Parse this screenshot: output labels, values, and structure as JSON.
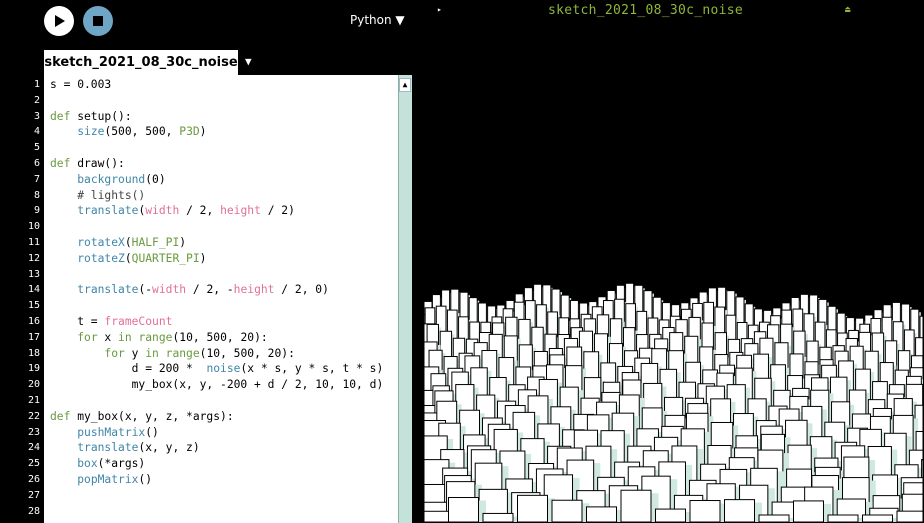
{
  "toolbar": {
    "run_icon": "play-icon",
    "stop_icon": "stop-icon",
    "mode_label": "Python ▼"
  },
  "tab": {
    "name": "sketch_2021_08_30c_noise",
    "menu_icon": "▼"
  },
  "sketch_window": {
    "title": "sketch_2021_08_30c_noise",
    "play_icon": "▸",
    "eject_icon": "⏏"
  },
  "colors": {
    "keyword": "#6a9a3f",
    "builtin": "#3f86a8",
    "constant": "#e0709a",
    "scrollbar": "#c5e2da",
    "stop_button": "#6fa6c6"
  },
  "code": [
    [
      [
        "s = 0.003",
        ""
      ]
    ],
    [],
    [
      [
        "def",
        "k"
      ],
      [
        " setup():",
        ""
      ]
    ],
    [
      [
        "    ",
        ""
      ],
      [
        "size",
        "f"
      ],
      [
        "(500, 500, ",
        ""
      ],
      [
        "P3D",
        "n"
      ],
      [
        ")",
        ""
      ]
    ],
    [],
    [
      [
        "def",
        "k"
      ],
      [
        " draw():",
        ""
      ]
    ],
    [
      [
        "    ",
        ""
      ],
      [
        "background",
        "f"
      ],
      [
        "(0)",
        ""
      ]
    ],
    [
      [
        "    # lights()",
        "m"
      ]
    ],
    [
      [
        "    ",
        ""
      ],
      [
        "translate",
        "f"
      ],
      [
        "(",
        ""
      ],
      [
        "width",
        "c"
      ],
      [
        " / 2, ",
        ""
      ],
      [
        "height",
        "c"
      ],
      [
        " / 2)",
        ""
      ]
    ],
    [],
    [
      [
        "    ",
        ""
      ],
      [
        "rotateX",
        "f"
      ],
      [
        "(",
        ""
      ],
      [
        "HALF_PI",
        "n"
      ],
      [
        ")",
        ""
      ]
    ],
    [
      [
        "    ",
        ""
      ],
      [
        "rotateZ",
        "f"
      ],
      [
        "(",
        ""
      ],
      [
        "QUARTER_PI",
        "n"
      ],
      [
        ")",
        ""
      ]
    ],
    [],
    [
      [
        "    ",
        ""
      ],
      [
        "translate",
        "f"
      ],
      [
        "(-",
        ""
      ],
      [
        "width",
        "c"
      ],
      [
        " / 2, -",
        ""
      ],
      [
        "height",
        "c"
      ],
      [
        " / 2, 0)",
        ""
      ]
    ],
    [],
    [
      [
        "    t = ",
        ""
      ],
      [
        "frameCount",
        "c"
      ]
    ],
    [
      [
        "    ",
        ""
      ],
      [
        "for",
        "k"
      ],
      [
        " x ",
        ""
      ],
      [
        "in",
        "k"
      ],
      [
        " ",
        ""
      ],
      [
        "range",
        "k"
      ],
      [
        "(10, 500, 20):",
        ""
      ]
    ],
    [
      [
        "        ",
        ""
      ],
      [
        "for",
        "k"
      ],
      [
        " y ",
        ""
      ],
      [
        "in",
        "k"
      ],
      [
        " ",
        ""
      ],
      [
        "range",
        "k"
      ],
      [
        "(10, 500, 20):",
        ""
      ]
    ],
    [
      [
        "            d = 200 *  ",
        ""
      ],
      [
        "noise",
        "f"
      ],
      [
        "(x * s, y * s, t * s)",
        ""
      ]
    ],
    [
      [
        "            my_box(x, y, -200 + d / 2, 10, 10, d)",
        ""
      ]
    ],
    [],
    [
      [
        "def",
        "k"
      ],
      [
        " my_box(x, y, z, *args):",
        ""
      ]
    ],
    [
      [
        "    ",
        ""
      ],
      [
        "pushMatrix",
        "f"
      ],
      [
        "()",
        ""
      ]
    ],
    [
      [
        "    ",
        ""
      ],
      [
        "translate",
        "f"
      ],
      [
        "(x, y, z)",
        ""
      ]
    ],
    [
      [
        "    ",
        ""
      ],
      [
        "box",
        "f"
      ],
      [
        "(*args)",
        ""
      ]
    ],
    [
      [
        "    ",
        ""
      ],
      [
        "popMatrix",
        "f"
      ],
      [
        "()",
        ""
      ]
    ],
    [],
    []
  ]
}
